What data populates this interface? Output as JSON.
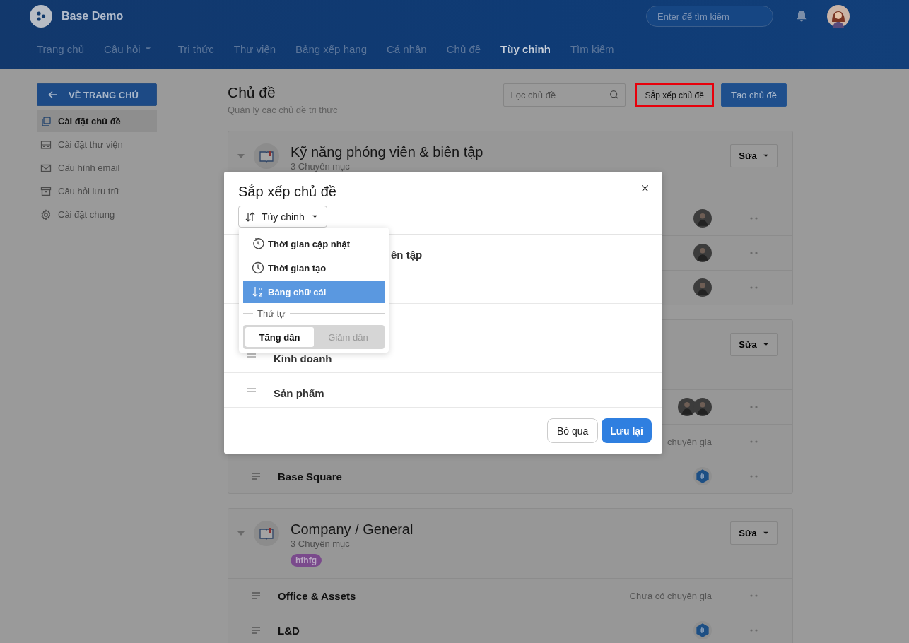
{
  "header": {
    "brand": "Base Demo",
    "search": {
      "placeholder": "Enter để tìm kiếm"
    },
    "nav": [
      {
        "label": "Trang chủ",
        "selected": false,
        "has_menu": false
      },
      {
        "label": "Câu hỏi",
        "selected": false,
        "has_menu": true
      },
      {
        "label": "Tri thức",
        "selected": false,
        "has_menu": false
      },
      {
        "label": "Thư viện",
        "selected": false,
        "has_menu": false
      },
      {
        "label": "Bảng xếp hạng",
        "selected": false,
        "has_menu": false
      },
      {
        "label": "Cá nhân",
        "selected": false,
        "has_menu": false
      },
      {
        "label": "Chủ đề",
        "selected": false,
        "has_menu": false
      },
      {
        "label": "Tùy chỉnh",
        "selected": true,
        "has_menu": false
      },
      {
        "label": "Tìm kiếm",
        "selected": false,
        "has_menu": false
      }
    ]
  },
  "sidebar": {
    "back_button": "VỀ TRANG CHỦ",
    "items": [
      {
        "label": "Cài đặt chủ đề",
        "selected": true
      },
      {
        "label": "Cài đặt thư viện",
        "selected": false
      },
      {
        "label": "Cấu hình email",
        "selected": false
      },
      {
        "label": "Câu hỏi lưu trữ",
        "selected": false
      },
      {
        "label": "Cài đặt chung",
        "selected": false
      }
    ]
  },
  "page": {
    "title": "Chủ đề",
    "subtitle": "Quản lý các chủ đề tri thức",
    "filter": {
      "placeholder": "Lọc chủ đề"
    },
    "sort_button": {
      "label": "Sắp xếp chủ đề",
      "highlighted": true
    },
    "create_button": "Tạo chủ đề"
  },
  "topics": [
    {
      "title": "Kỹ năng phóng viên & biên tập",
      "count": "3 Chuyên mục",
      "edit": "Sửa",
      "rows": [
        {
          "experts": [
            {
              "kind": "photo"
            }
          ]
        },
        {
          "experts": [
            {
              "kind": "photo"
            }
          ]
        },
        {
          "experts": [
            {
              "kind": "photo"
            }
          ]
        }
      ]
    },
    {
      "edit": "Sửa",
      "rows": [
        {
          "experts": [
            {
              "kind": "photo"
            },
            {
              "kind": "photo"
            }
          ]
        },
        {
          "note": "chuyên gia"
        },
        {
          "label": "Base Square",
          "experts": [
            {
              "kind": "badge"
            }
          ]
        }
      ]
    },
    {
      "title": "Company / General",
      "count": "3 Chuyên mục",
      "tag": {
        "label": "hfhfg",
        "color": "#7a4a8c"
      },
      "edit": "Sửa",
      "rows": [
        {
          "label": "Office & Assets",
          "note": "Chưa có chuyên gia"
        },
        {
          "label": "L&D",
          "experts": [
            {
              "kind": "badge"
            }
          ]
        }
      ]
    }
  ],
  "modal": {
    "title": "Sắp xếp chủ đề",
    "sort_select": "Tùy chỉnh",
    "rows": [
      {
        "label": "ên tập",
        "covered": true
      },
      {
        "label": "Kinh doanh",
        "covered": false
      },
      {
        "label": "Sản phẩm",
        "covered": false
      }
    ],
    "cancel": "Bỏ qua",
    "save": "Lưu lại",
    "sort_menu": {
      "options": [
        {
          "label": "Thời gian cập nhật",
          "selected": false
        },
        {
          "label": "Thời gian tạo",
          "selected": false
        },
        {
          "label": "Bảng chữ cái",
          "selected": true
        }
      ],
      "order_label": "Thứ tự",
      "order": [
        {
          "label": "Tăng dần",
          "selected": true
        },
        {
          "label": "Giảm dần",
          "selected": false
        }
      ]
    }
  }
}
